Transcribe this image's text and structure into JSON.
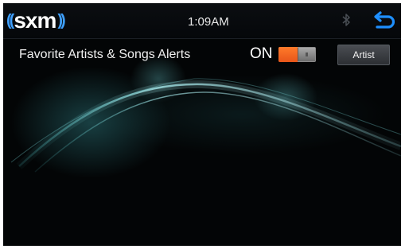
{
  "status_bar": {
    "logo_text": "sxm",
    "time": "1:09AM",
    "bluetooth_icon": "bluetooth-icon",
    "back_icon": "back-arrow-icon"
  },
  "alerts": {
    "title": "Favorite Artists & Songs Alerts",
    "toggle_state_label": "ON",
    "toggle_on": true,
    "artist_button_label": "Artist"
  },
  "colors": {
    "background": "#030506",
    "accent_orange": "#e8561a",
    "logo_blue": "#3fa0ff",
    "back_icon_blue": "#1e8fff",
    "wave_teal": "#4fc6c8"
  }
}
